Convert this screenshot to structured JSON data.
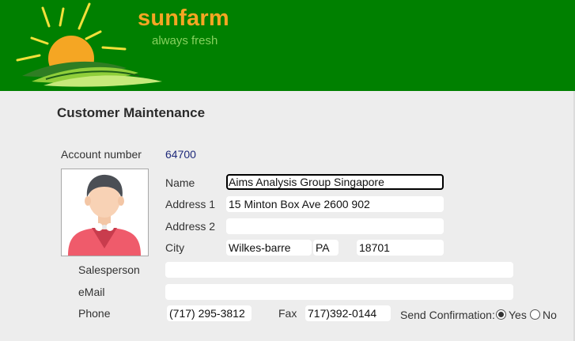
{
  "brand": {
    "name": "sunfarm",
    "tagline": "always fresh"
  },
  "page": {
    "title": "Customer Maintenance"
  },
  "account": {
    "label": "Account number",
    "value": "64700"
  },
  "form": {
    "name_label": "Name",
    "name_value": "Aims Analysis Group Singapore",
    "address1_label": "Address 1",
    "address1_value": "15 Minton Box Ave 2600 902",
    "address2_label": "Address 2",
    "address2_value": "",
    "city_label": "City",
    "city_value": "Wilkes-barre",
    "state_value": "PA",
    "zip_value": "18701",
    "salesperson_label": "Salesperson",
    "salesperson_value": "",
    "email_label": "eMail",
    "email_value": "",
    "phone_label": "Phone",
    "phone_value": "(717) 295-3812",
    "fax_label": "Fax",
    "fax_value": "717)392-0144",
    "confirm_label": "Send Confirmation:",
    "confirm_yes": "Yes",
    "confirm_no": "No",
    "confirm_selected": "Yes"
  },
  "colors": {
    "header_bg": "#008000",
    "brand": "#f5a623",
    "tagline": "#86d15e",
    "account_value": "#1f2a7a"
  },
  "icons": {
    "logo": "sun-over-field-logo",
    "avatar": "person-avatar-icon"
  }
}
